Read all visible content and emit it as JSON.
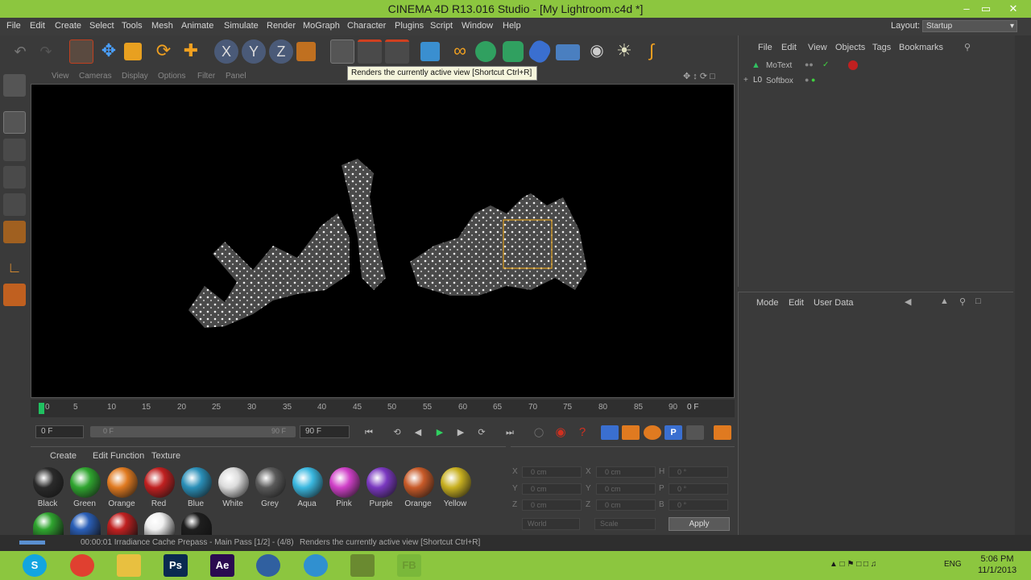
{
  "window": {
    "title": "CINEMA 4D R13.016 Studio - [My Lightroom.c4d *]"
  },
  "menu": [
    "File",
    "Edit",
    "Create",
    "Select",
    "Tools",
    "Mesh",
    "Animate",
    "Simulate",
    "Render",
    "MoGraph",
    "Character",
    "Plugins",
    "Script",
    "Window",
    "Help"
  ],
  "layout": {
    "label": "Layout:",
    "value": "Startup"
  },
  "viewport": {
    "menu": [
      "View",
      "Cameras",
      "Display",
      "Options",
      "Filter",
      "Panel"
    ],
    "tooltip": "Renders the currently active view [Shortcut Ctrl+R]"
  },
  "timeline": {
    "ticks": [
      "0",
      "5",
      "10",
      "15",
      "20",
      "25",
      "30",
      "35",
      "40",
      "45",
      "50",
      "55",
      "60",
      "65",
      "70",
      "75",
      "80",
      "85",
      "90"
    ],
    "current_frame": "0 F"
  },
  "transport": {
    "start_field": "0 F",
    "range_field": "90 F",
    "range_end_field": "90 F",
    "range_start_field": "0 F"
  },
  "materials": {
    "menu": [
      "Create",
      "Edit",
      "Function",
      "Texture"
    ],
    "items": [
      {
        "name": "Black",
        "color": "#2a2a2a"
      },
      {
        "name": "Green",
        "color": "#2fa52f"
      },
      {
        "name": "Orange",
        "color": "#e07a20"
      },
      {
        "name": "Red",
        "color": "#c02020"
      },
      {
        "name": "Blue",
        "color": "#2a8fb8"
      },
      {
        "name": "White",
        "color": "#dcdcdc"
      },
      {
        "name": "Grey",
        "color": "#5a5a5a"
      },
      {
        "name": "Aqua",
        "color": "#3ab8e0"
      },
      {
        "name": "Pink",
        "color": "#d040c8"
      },
      {
        "name": "Purple",
        "color": "#7a38c0"
      },
      {
        "name": "Orange",
        "color": "#c85a28"
      },
      {
        "name": "Yellow",
        "color": "#c8b020"
      }
    ],
    "row2_colors": [
      "#2fa52f",
      "#2a5fb8",
      "#c02020",
      "#f0f0f0",
      "#1e1e1e"
    ]
  },
  "coordinates": {
    "rows": [
      {
        "a": "X",
        "av": "0 cm",
        "b": "X",
        "bv": "0 cm",
        "c": "H",
        "cv": "0 °"
      },
      {
        "a": "Y",
        "av": "0 cm",
        "b": "Y",
        "bv": "0 cm",
        "c": "P",
        "cv": "0 °"
      },
      {
        "a": "Z",
        "av": "0 cm",
        "b": "Z",
        "bv": "0 cm",
        "c": "B",
        "cv": "0 °"
      }
    ],
    "world": "World",
    "scale": "Scale",
    "apply": "Apply"
  },
  "objects_panel": {
    "menu": [
      "File",
      "Edit",
      "View",
      "Objects",
      "Tags",
      "Bookmarks"
    ],
    "items": [
      {
        "name": "MoText"
      },
      {
        "name": "Softbox"
      }
    ]
  },
  "attributes_panel": {
    "menu": [
      "Mode",
      "Edit",
      "User Data"
    ]
  },
  "status": {
    "progress_text": "00:00:01 Irradiance Cache Prepass - Main Pass [1/2] - (4/8)",
    "message": "Renders the currently active view [Shortcut Ctrl+R]"
  },
  "taskbar": {
    "language": "ENG",
    "time": "5:06 PM",
    "date": "11/1/2013"
  }
}
